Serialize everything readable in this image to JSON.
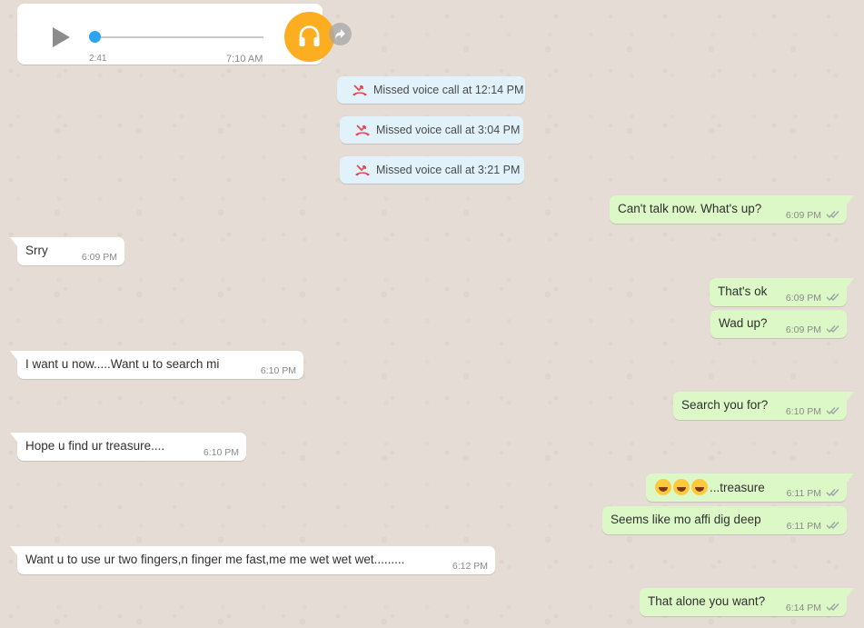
{
  "voice_message": {
    "duration": "2:41",
    "time": "7:10 AM",
    "progress": 0
  },
  "missed_calls": [
    {
      "label": "Missed voice call at 12:14 PM"
    },
    {
      "label": "Missed voice call at 3:04 PM"
    },
    {
      "label": "Missed voice call at 3:21 PM"
    }
  ],
  "messages": [
    {
      "direction": "out",
      "text": "Can't talk now. What's up?",
      "time": "6:09 PM"
    },
    {
      "direction": "in",
      "text": "Srry",
      "time": "6:09 PM"
    },
    {
      "direction": "out",
      "text": "That's ok",
      "time": "6:09 PM"
    },
    {
      "direction": "out",
      "text": "Wad up?",
      "time": "6:09 PM"
    },
    {
      "direction": "in",
      "text": "I want u now.....Want u to search mi",
      "time": "6:10 PM"
    },
    {
      "direction": "out",
      "text": "Search you for?",
      "time": "6:10 PM"
    },
    {
      "direction": "in",
      "text": "Hope u find ur treasure....",
      "time": "6:10 PM"
    },
    {
      "direction": "out",
      "text": "...treasure",
      "emoji_prefix": "😅😅😅",
      "time": "6:11 PM"
    },
    {
      "direction": "out",
      "text": "Seems like mo affi dig deep",
      "time": "6:11 PM"
    },
    {
      "direction": "in",
      "text": "Want u to use ur two fingers,n finger me fast,me me wet wet wet.........",
      "time": "6:12 PM"
    },
    {
      "direction": "out",
      "text": "That alone you want?",
      "time": "6:14 PM"
    }
  ],
  "colors": {
    "background": "#e5ddd5",
    "incoming_bubble": "#ffffff",
    "outgoing_bubble": "#dcf8c6",
    "system_bubble": "#e1f2fb",
    "headset_button": "#fdae20",
    "progress_knob": "#2ba4f0",
    "missed_call_icon": "#e8464a",
    "read_ticks": "#9aa0a6"
  },
  "icons": {
    "play": "play-icon",
    "headset": "headset-icon",
    "forward": "forward-icon",
    "missed_call": "missed-call-icon",
    "read_receipt": "double-check-icon"
  }
}
